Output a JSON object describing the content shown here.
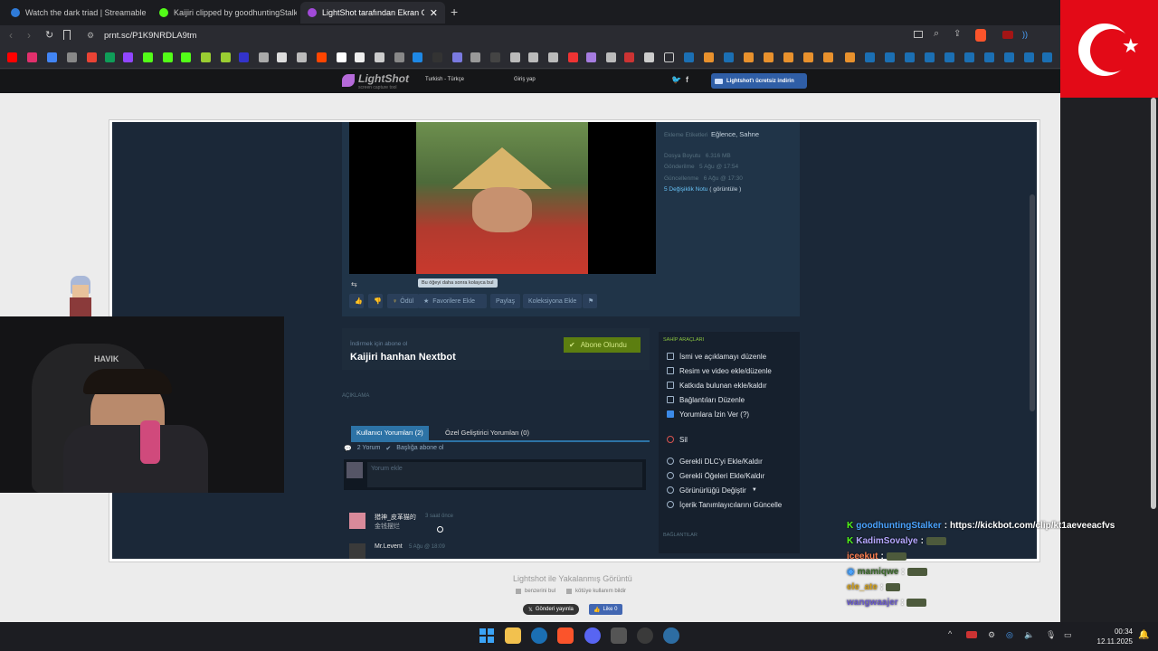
{
  "tabs": [
    {
      "label": "Watch the dark triad | Streamable",
      "active": false
    },
    {
      "label": "Kaijiri clipped by goodhuntingStalker",
      "active": false
    },
    {
      "label": "LightShot tarafından Ekran Görü",
      "active": true
    }
  ],
  "address": {
    "url": "prnt.sc/P1K9NRDLA9tm"
  },
  "lightshot": {
    "logo": "LightShot",
    "logo_sub": "screen capture tool",
    "lang": "Turkish - Türkçe",
    "login": "Giriş yap",
    "download": "Lightshot'ı ücretsiz indirin",
    "footer_title": "Lightshot ile Yakalanmış Görüntü",
    "similar": "benzerini bul",
    "report": "kötüye kullanım bildir",
    "share_x": "Gönderi yayınla",
    "like": "Like 0"
  },
  "steam": {
    "tooltip": "Bu öğeyi daha sonra kolayca bul",
    "meta": {
      "tags_label": "Ekleme Etiketleri",
      "tags": "Eğlence, Sahne",
      "size_label": "Dosya Boyutu",
      "size": "6.316 MB",
      "posted_label": "Gönderilme",
      "posted": "5 Ağu @ 17:54",
      "updated_label": "Güncellenme",
      "updated": "6 Ağu @ 17:30",
      "changes": "5 Değişiklik Notu",
      "view": "( görüntüle )"
    },
    "actions": {
      "award": "Ödül",
      "fav": "Favorilere Ekle",
      "share": "Paylaş",
      "collection": "Koleksiyona Ekle"
    },
    "subscribe_hint": "İndirmek için abone ol",
    "item_title": "Kaijiri hanhan Nextbot",
    "subscribed": "Abone Olundu",
    "description_label": "AÇIKLAMA",
    "owner_tools": "SAHİP ARAÇLARI",
    "owner_items": [
      "İsmi ve açıklamayı düzenle",
      "Resim ve video ekle/düzenle",
      "Katkıda bulunan ekle/kaldır",
      "Bağlantıları Düzenle",
      "Yorumlara İzin Ver (?)"
    ],
    "delete": "Sil",
    "dlc_items": [
      "Gerekli DLC'yi Ekle/Kaldır",
      "Gerekli Öğeleri Ekle/Kaldır",
      "Görünürlüğü Değiştir",
      "İçerik Tanımlayıcılarını Güncelle"
    ],
    "links_label": "BAĞLANTILAR",
    "comment_tabs": [
      "Kullanıcı Yorumları (2)",
      "Özel Geliştirici Yorumları (0)"
    ],
    "comment_count": "2 Yorum",
    "subscribe_thread": "Başlığa abone ol",
    "comment_placeholder": "Yorum ekle",
    "comments": [
      {
        "author": "猎神_皮革猫的",
        "time": "3 saat önce",
        "text": "金钱摆烂"
      },
      {
        "author": "Mr.Levent",
        "time": "5 Ağu @ 18:09",
        "text": ""
      }
    ]
  },
  "chat": [
    {
      "user": "goodhuntingStalker",
      "color": "#4aa3ff",
      "msg": "https://kickbot.com/clip/kt1aeveeacfvs"
    },
    {
      "user": "KadimSovalye",
      "color": "#b6a7ff",
      "msg": ""
    },
    {
      "user": "iceekut",
      "color": "#ff7f50",
      "msg": ""
    },
    {
      "user": "mamiqwe",
      "color": "#3d6b2c",
      "msg": ""
    },
    {
      "user": "ele_ate",
      "color": "#d4a017",
      "msg": ""
    },
    {
      "user": "wangwaajer",
      "color": "#6a5acd",
      "msg": ""
    }
  ],
  "tray": {
    "time": "00:34",
    "date": "12.11.2025"
  },
  "colors": {
    "steam_bg": "#1b2838",
    "green": "#5c7e10",
    "accent": "#66c0f4"
  }
}
